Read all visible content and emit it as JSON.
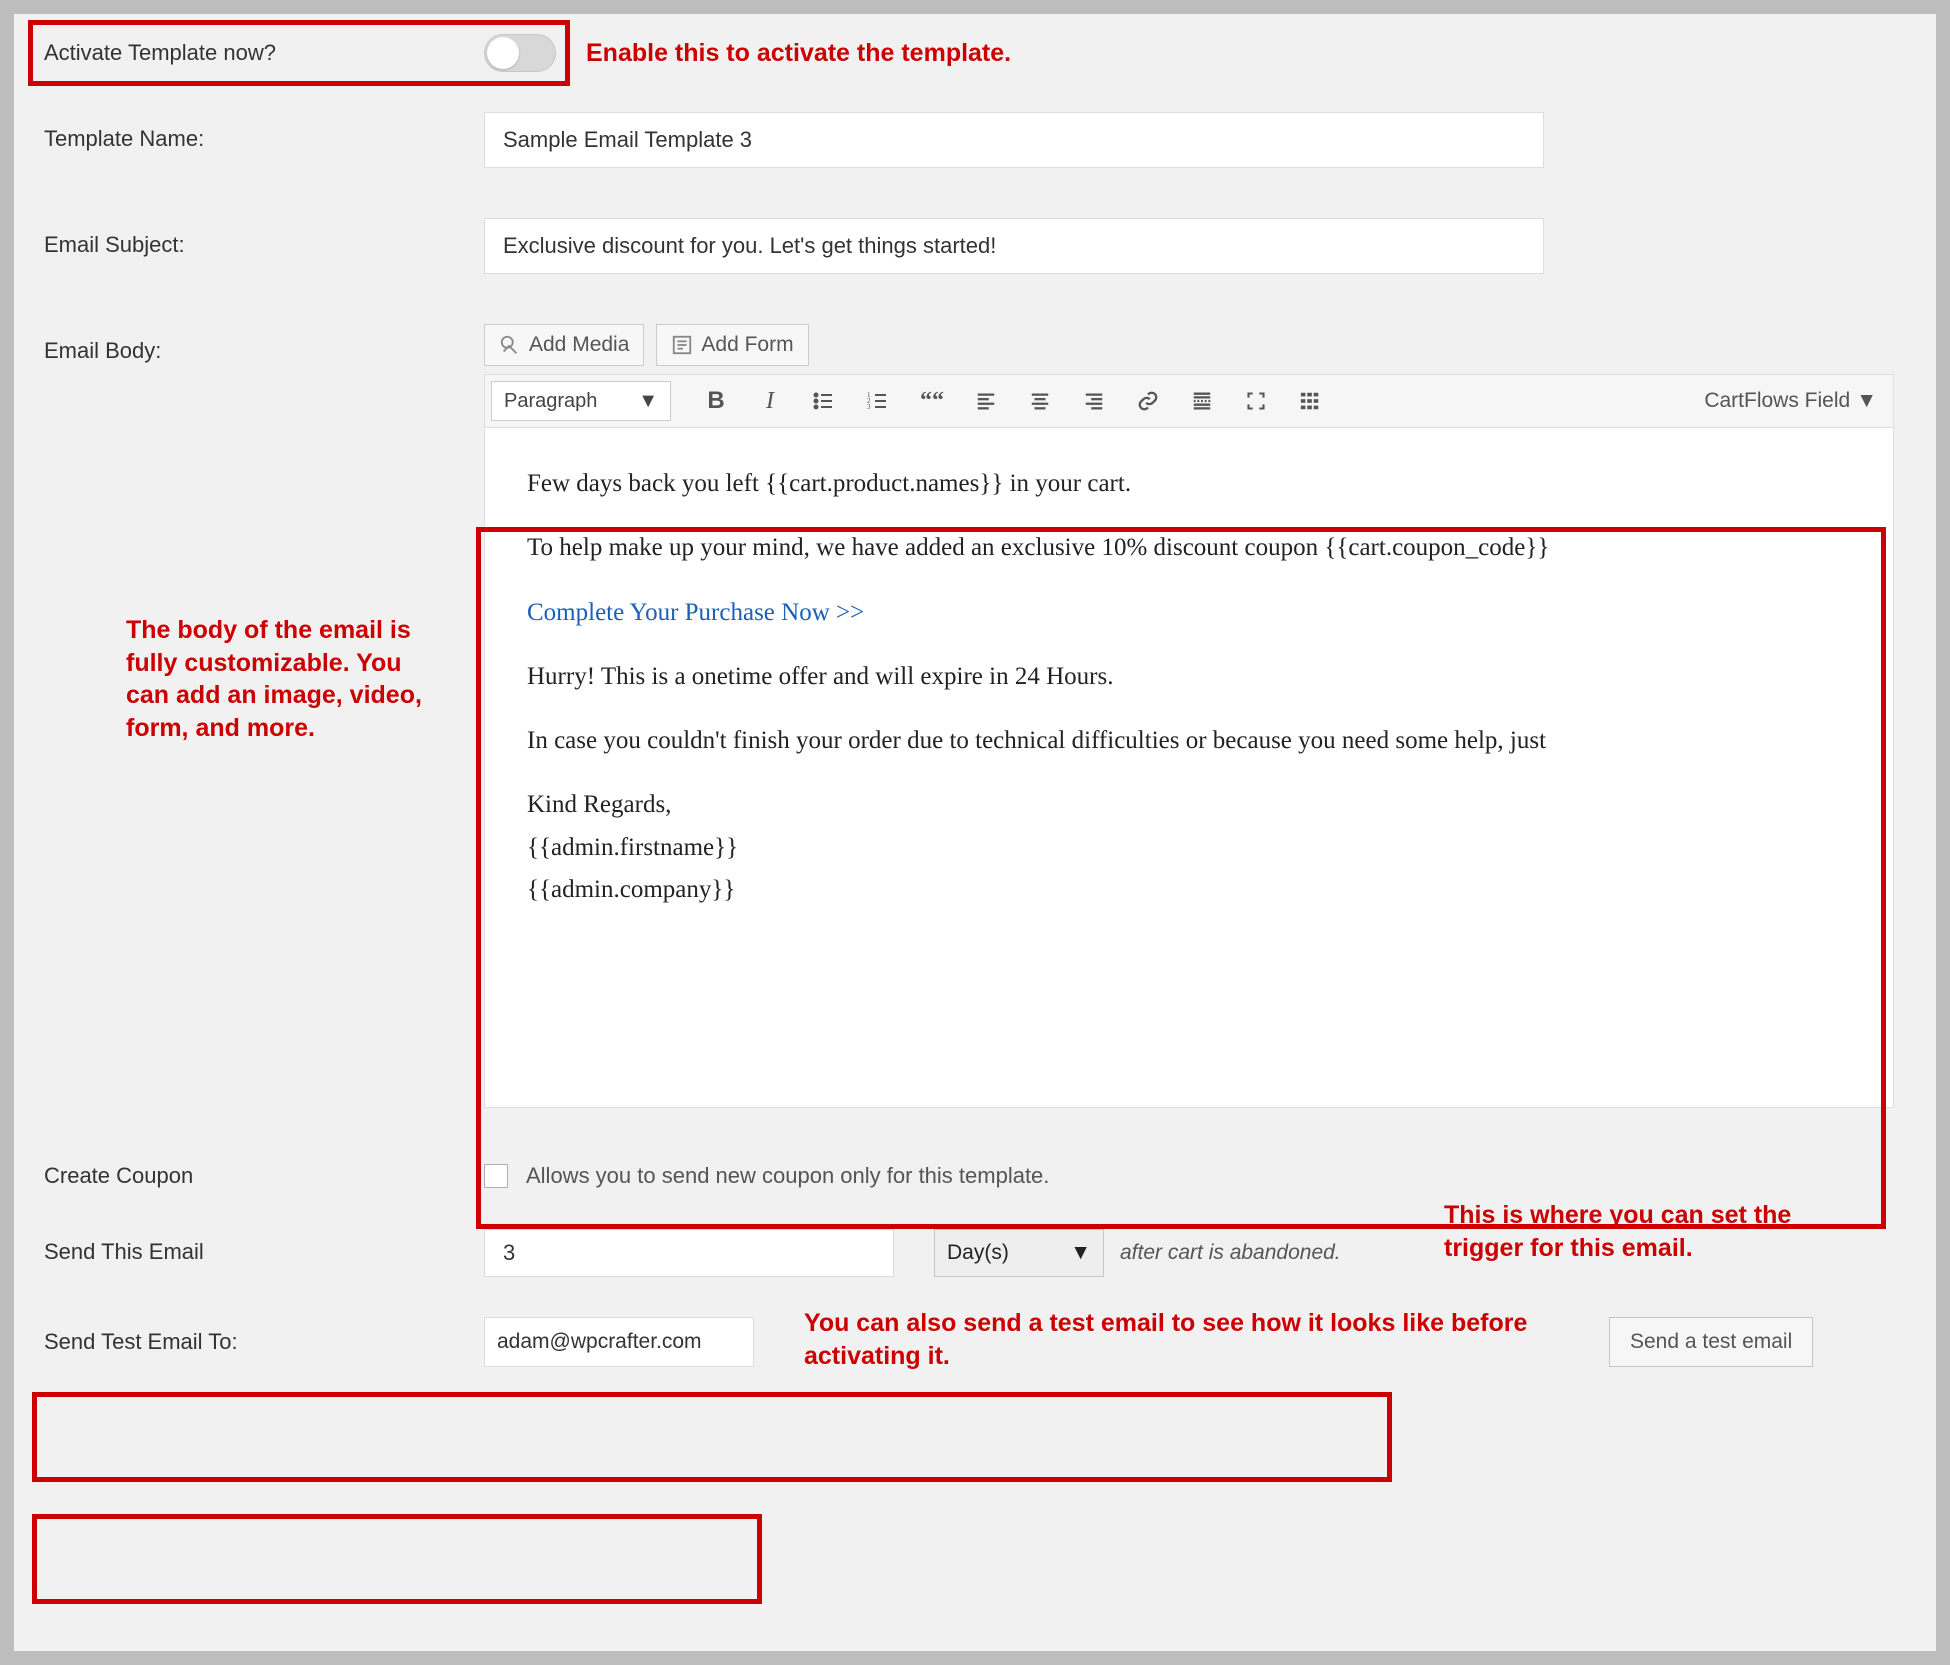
{
  "activate": {
    "label": "Activate Template now?",
    "callout": "Enable this to activate the template."
  },
  "templateName": {
    "label": "Template Name:",
    "value": "Sample Email Template 3"
  },
  "emailSubject": {
    "label": "Email Subject:",
    "value": "Exclusive discount for you. Let's get things started!"
  },
  "emailBody": {
    "label": "Email Body:",
    "addMedia": "Add Media",
    "addForm": "Add Form",
    "formatSelect": "Paragraph",
    "cartflowsField": "CartFlows Field",
    "calloutSide": "The body of the email is fully customizable. You can add an image, video, form, and more.",
    "content": {
      "p1": "Few days back you left {{cart.product.names}} in your cart.",
      "p2": "To help make up your mind, we have added an exclusive 10% discount coupon {{cart.coupon_code}}",
      "link": "Complete Your Purchase Now >>",
      "p3": "Hurry! This is a onetime offer and will expire in 24 Hours.",
      "p4": "In case you couldn't finish your order due to technical difficulties or because you need some help, just",
      "p5": "Kind Regards,",
      "p6": "{{admin.firstname}}",
      "p7": "{{admin.company}}"
    }
  },
  "coupon": {
    "label": "Create Coupon",
    "text": "Allows you to send new coupon only for this template."
  },
  "sendEmail": {
    "label": "Send This Email",
    "value": "3",
    "unit": "Day(s)",
    "hint": "after cart is abandoned.",
    "callout": "This is where you can set the trigger for this email."
  },
  "testEmail": {
    "label": "Send Test Email To:",
    "value": "adam@wpcrafter.com",
    "button": "Send a test email",
    "callout": "You can also send a test email to see how it looks like before activating it."
  }
}
